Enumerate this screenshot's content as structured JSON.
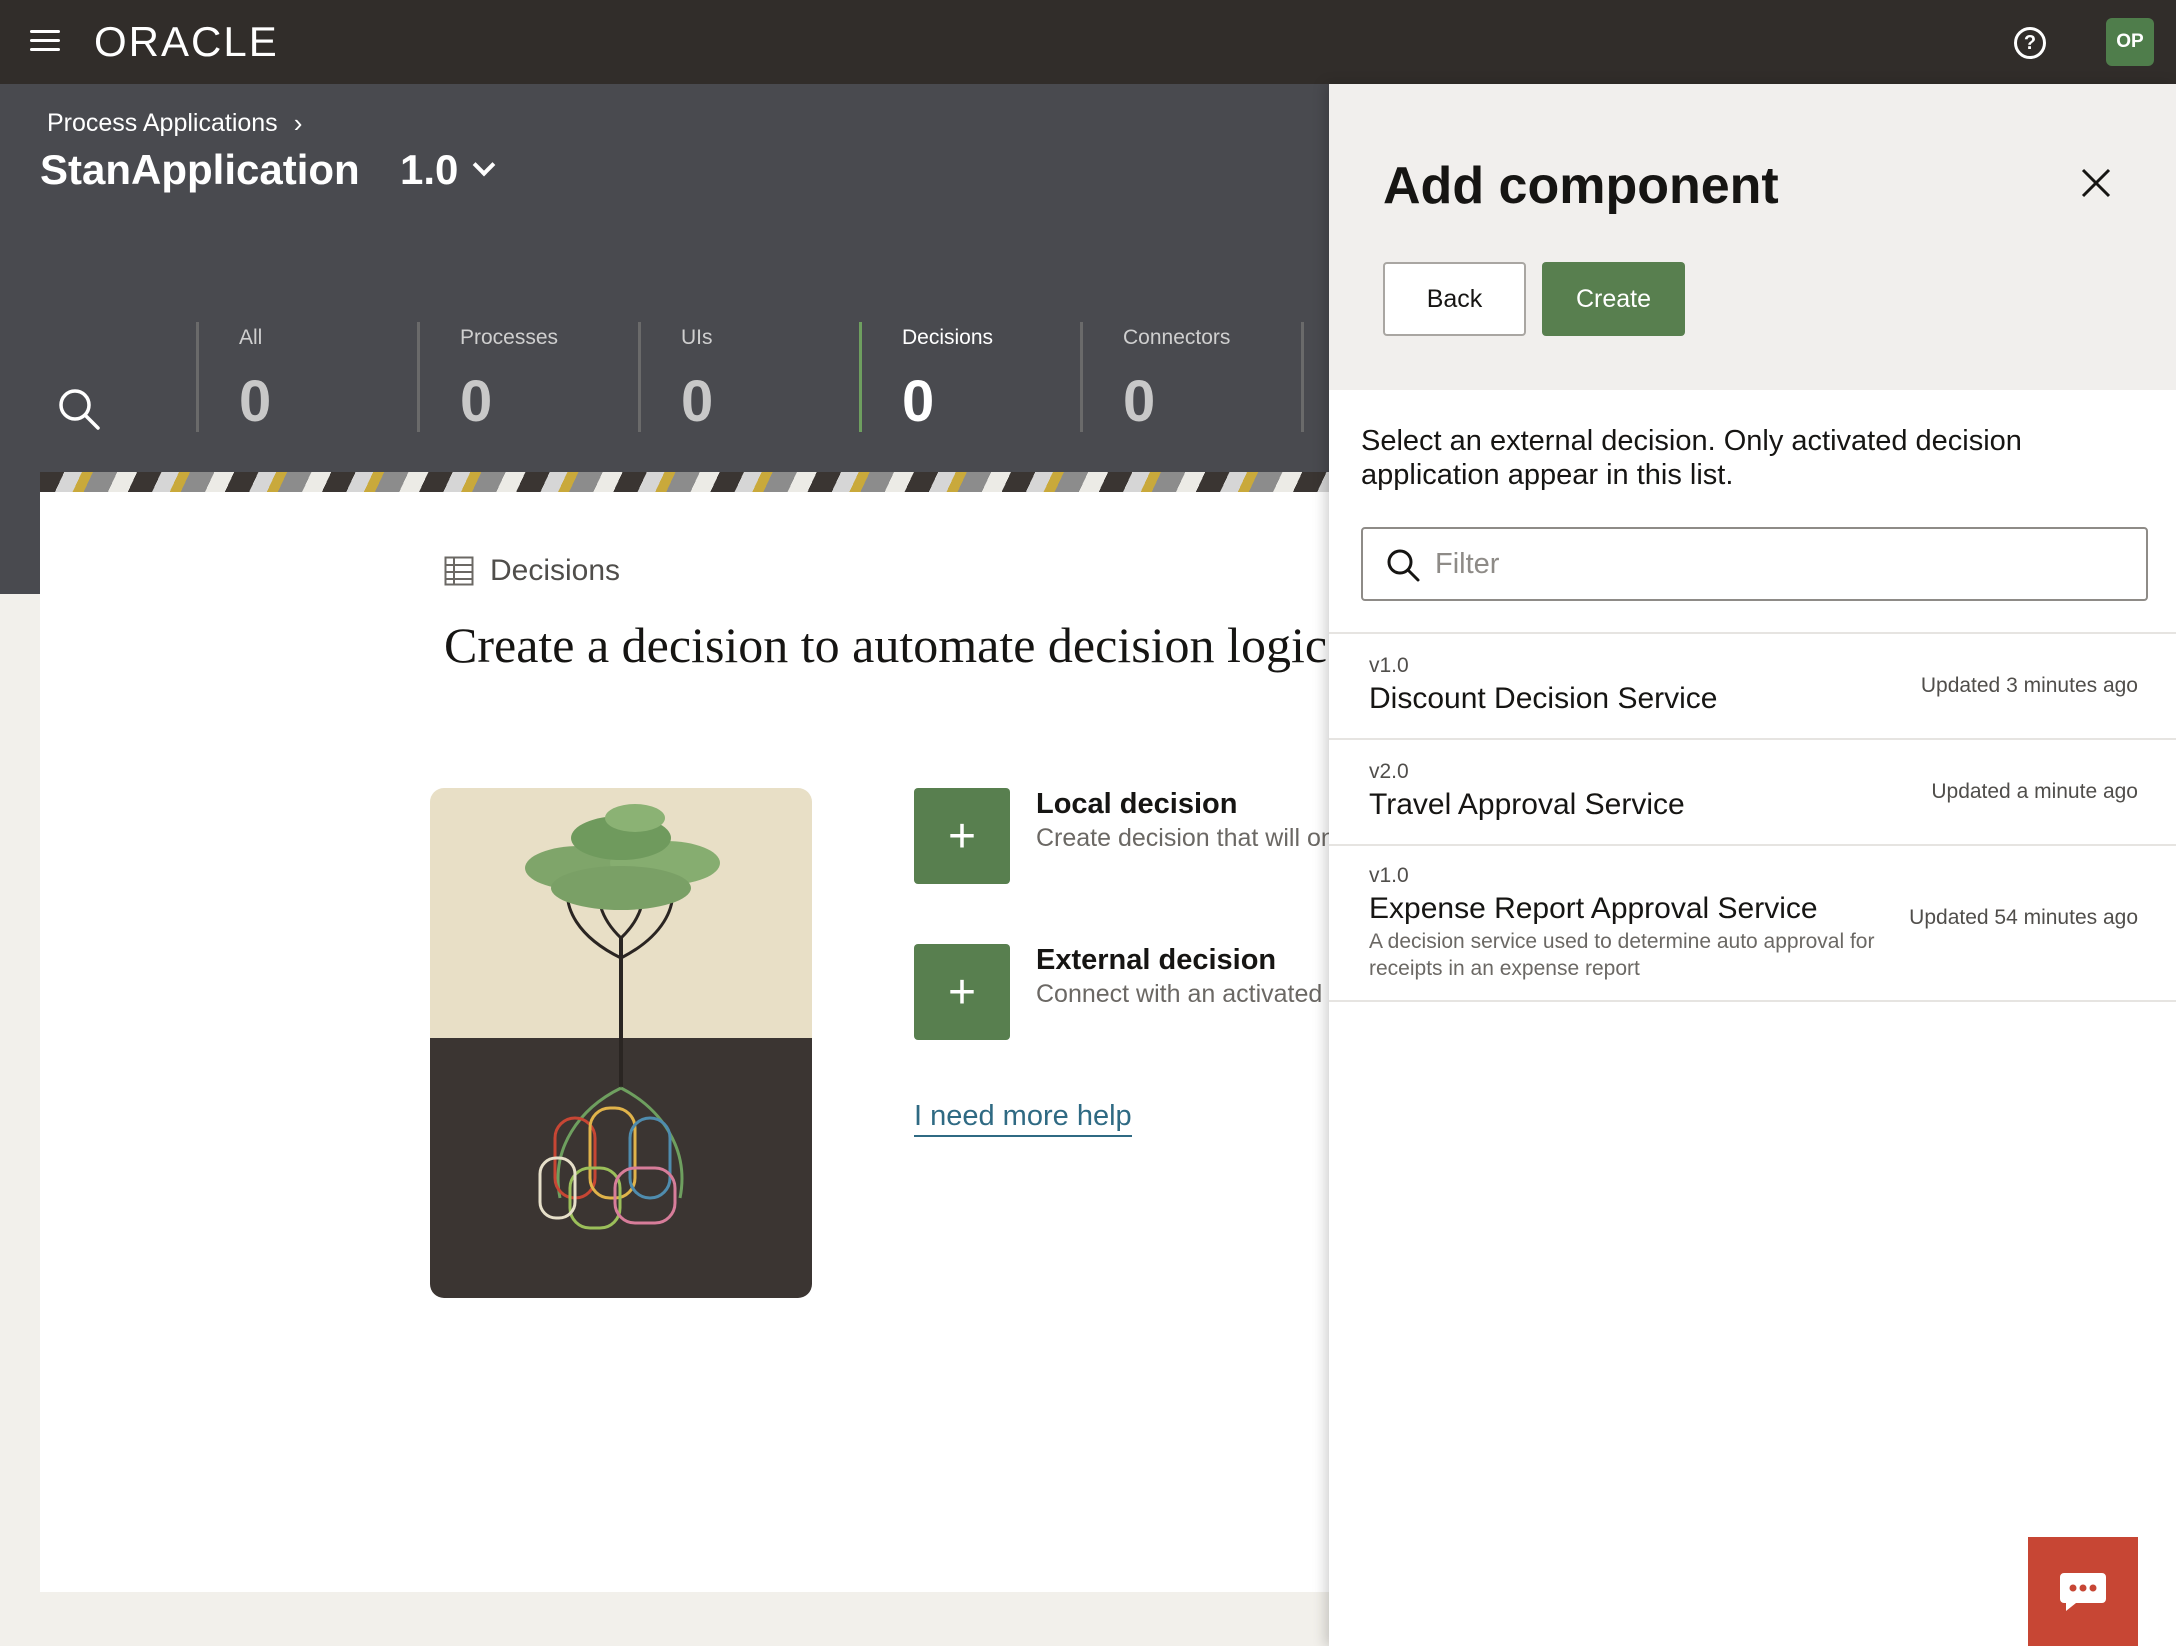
{
  "topbar": {
    "logo": "ORACLE",
    "help_glyph": "?",
    "avatar_initials": "OP",
    "icons": [
      "menu-icon",
      "help-icon"
    ]
  },
  "header": {
    "breadcrumb": "Process Applications",
    "app_name": "StanApplication",
    "version": "1.0"
  },
  "stats": [
    {
      "label": "All",
      "value": "0"
    },
    {
      "label": "Processes",
      "value": "0"
    },
    {
      "label": "UIs",
      "value": "0"
    },
    {
      "label": "Decisions",
      "value": "0",
      "active": true
    },
    {
      "label": "Connectors",
      "value": "0"
    }
  ],
  "main": {
    "section_label": "Decisions",
    "headline": "Create a decision to automate decision logic",
    "options": [
      {
        "title": "Local decision",
        "desc": "Create decision that will only be used in this application"
      },
      {
        "title": "External decision",
        "desc": "Connect with an activated decision application"
      }
    ],
    "help_link": "I need more help"
  },
  "panel": {
    "title": "Add component",
    "back_label": "Back",
    "create_label": "Create",
    "description": "Select an external decision. Only activated decision application appear in this list.",
    "filter_placeholder": "Filter",
    "items": [
      {
        "version": "v1.0",
        "name": "Discount Decision Service",
        "updated": "Updated 3 minutes ago",
        "desc": ""
      },
      {
        "version": "v2.0",
        "name": "Travel Approval Service",
        "updated": "Updated a minute ago",
        "desc": ""
      },
      {
        "version": "v1.0",
        "name": "Expense Report Approval Service",
        "updated": "Updated 54 minutes ago",
        "desc": "A decision service used to determine auto approval for receipts in an expense report"
      }
    ]
  },
  "colors": {
    "topbar": "#312d2a",
    "header": "#494a4f",
    "accent_green": "#587f4f",
    "chat": "#c74634",
    "link": "#2f6a83"
  }
}
